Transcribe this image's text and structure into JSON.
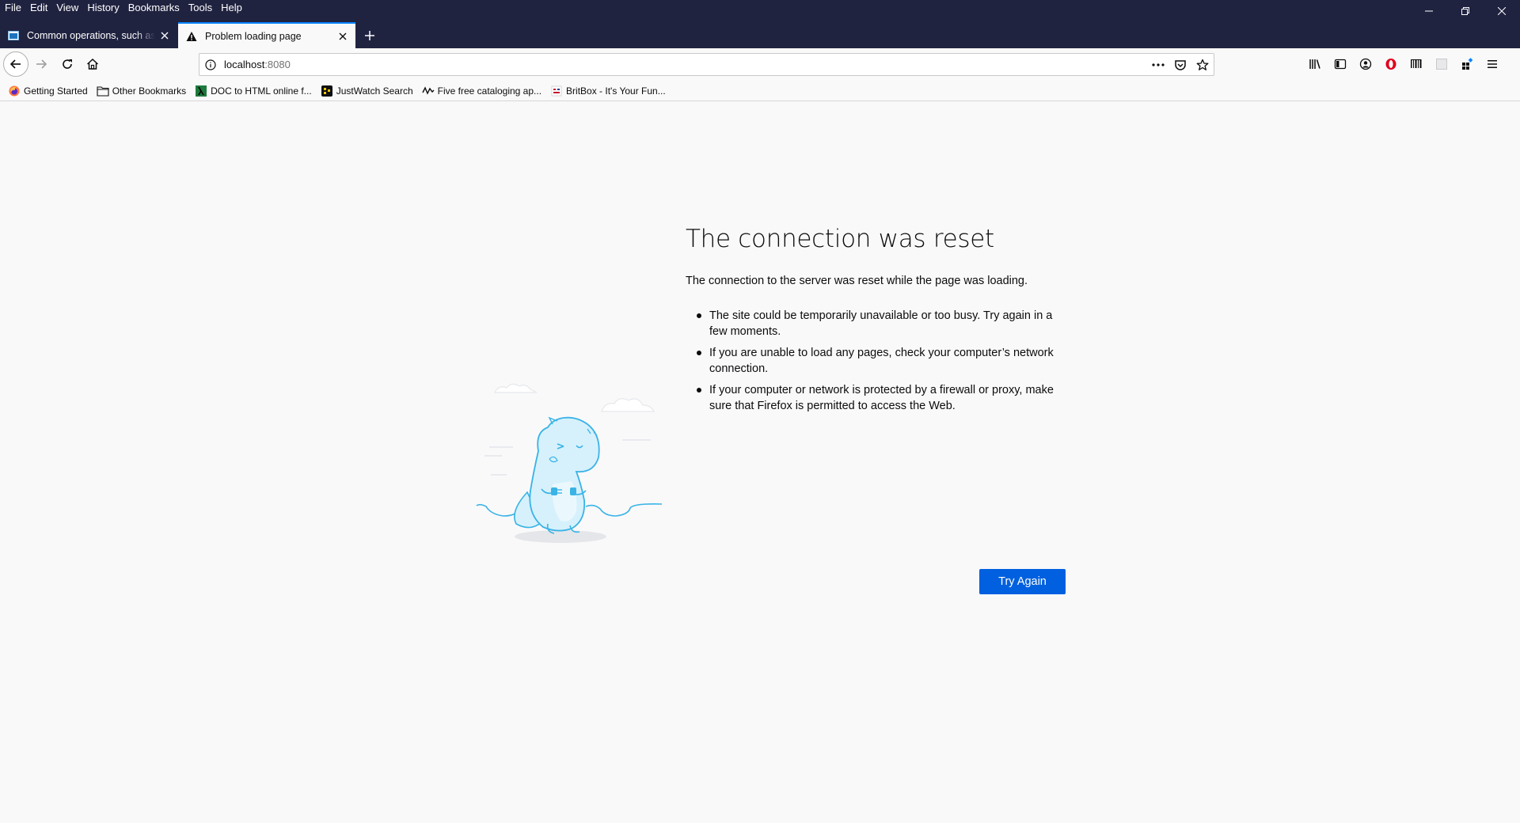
{
  "menubar": {
    "items": [
      {
        "label": "File"
      },
      {
        "label": "Edit"
      },
      {
        "label": "View"
      },
      {
        "label": "History"
      },
      {
        "label": "Bookmarks"
      },
      {
        "label": "Tools"
      },
      {
        "label": "Help"
      }
    ]
  },
  "tabs": [
    {
      "title": "Common operations, such as n",
      "active": false,
      "icon": "app-icon"
    },
    {
      "title": "Problem loading page",
      "active": true,
      "icon": "warning-icon"
    }
  ],
  "urlbar": {
    "host": "localhost",
    "port": ":8080"
  },
  "bookmarks": [
    {
      "label": "Getting Started",
      "icon": "firefox-icon"
    },
    {
      "label": "Other Bookmarks",
      "icon": "folder-icon"
    },
    {
      "label": "DOC to HTML online f...",
      "icon": "lambda-icon"
    },
    {
      "label": "JustWatch Search",
      "icon": "justwatch-icon"
    },
    {
      "label": "Five free cataloging ap...",
      "icon": "wave-icon"
    },
    {
      "label": "BritBox - It's Your Fun...",
      "icon": "britbox-icon"
    }
  ],
  "error": {
    "title": "The connection was reset",
    "description": "The connection to the server was reset while the page was loading.",
    "bullets": [
      "The site could be temporarily unavailable or too busy. Try again in a few moments.",
      "If you are unable to load any pages, check your computer’s network connection.",
      "If your computer or network is protected by a firewall or proxy, make sure that Firefox is permitted to access the Web."
    ],
    "button": "Try Again"
  },
  "colors": {
    "titlebar": "#202340",
    "accent": "#0060df",
    "tab_highlight": "#0a84ff",
    "page_bg": "#f9f9fa",
    "illustration": "#3ab3e6"
  }
}
